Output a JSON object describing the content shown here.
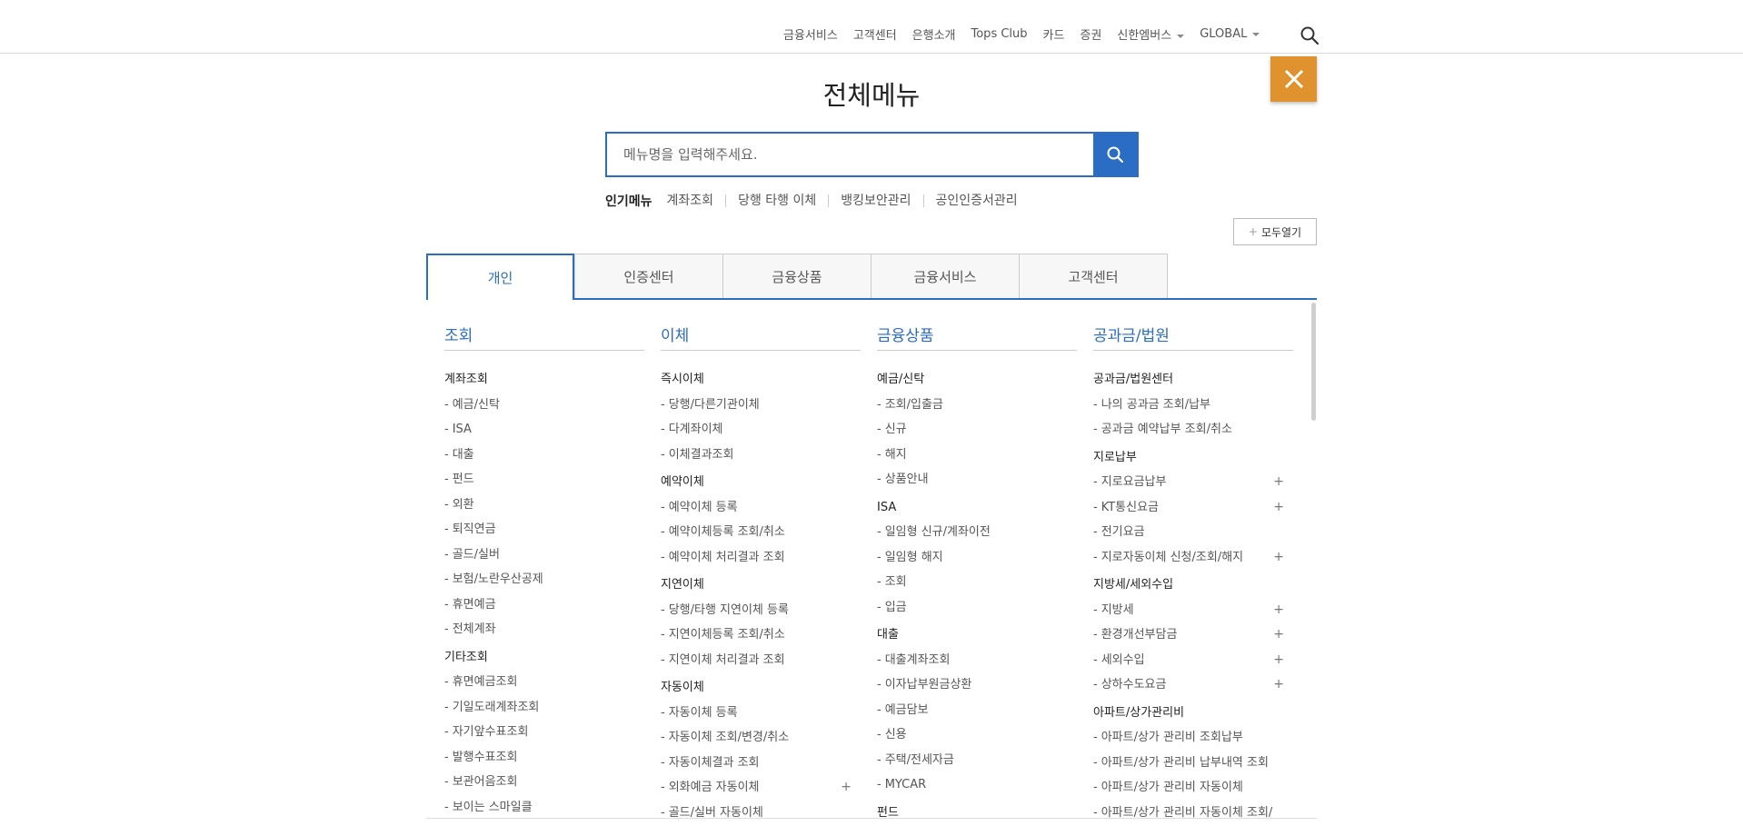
{
  "topnav": {
    "items": [
      {
        "label": "금융서비스",
        "dropdown": false
      },
      {
        "label": "고객센터",
        "dropdown": false
      },
      {
        "label": "은행소개",
        "dropdown": false
      },
      {
        "label": "Tops Club",
        "dropdown": false
      },
      {
        "label": "카드",
        "dropdown": false
      },
      {
        "label": "증권",
        "dropdown": false
      },
      {
        "label": "신한엠버스",
        "dropdown": true
      },
      {
        "label": "GLOBAL",
        "dropdown": true
      }
    ],
    "search_icon": "search-icon"
  },
  "close_button": {
    "icon": "close-icon",
    "color": "#e0922f"
  },
  "title": "전체메뉴",
  "search": {
    "placeholder": "메뉴명을 입력해주세요.",
    "icon": "search-icon"
  },
  "popular": {
    "label": "인기메뉴",
    "items": [
      "계좌조회",
      "당행 타행 이체",
      "뱅킹보안관리",
      "공인인증서관리"
    ]
  },
  "expand_all": "모두열기",
  "tabs": [
    {
      "label": "개인",
      "active": true
    },
    {
      "label": "인증센터",
      "active": false
    },
    {
      "label": "금융상품",
      "active": false
    },
    {
      "label": "금융서비스",
      "active": false
    },
    {
      "label": "고객센터",
      "active": false
    }
  ],
  "accent_color": "#2b6cc4",
  "columns": [
    {
      "title": "조회",
      "rows": [
        {
          "type": "group",
          "label": "계좌조회"
        },
        {
          "type": "item",
          "label": "예금/신탁"
        },
        {
          "type": "item",
          "label": "ISA"
        },
        {
          "type": "item",
          "label": "대출"
        },
        {
          "type": "item",
          "label": "펀드"
        },
        {
          "type": "item",
          "label": "외환"
        },
        {
          "type": "item",
          "label": "퇴직연금"
        },
        {
          "type": "item",
          "label": "골드/실버"
        },
        {
          "type": "item",
          "label": "보험/노란우산공제"
        },
        {
          "type": "item",
          "label": "휴면예금"
        },
        {
          "type": "item",
          "label": "전체계좌"
        },
        {
          "type": "group",
          "label": "기타조회"
        },
        {
          "type": "item",
          "label": "휴면예금조회"
        },
        {
          "type": "item",
          "label": "기일도래계좌조회"
        },
        {
          "type": "item",
          "label": "자기앞수표조회"
        },
        {
          "type": "item",
          "label": "발행수표조회"
        },
        {
          "type": "item",
          "label": "보관어음조회"
        },
        {
          "type": "item",
          "label": "보이는 스마일클"
        }
      ]
    },
    {
      "title": "이체",
      "rows": [
        {
          "type": "group",
          "label": "즉시이체"
        },
        {
          "type": "item",
          "label": "당행/다른기관이체"
        },
        {
          "type": "item",
          "label": "다계좌이체"
        },
        {
          "type": "item",
          "label": "이체결과조회"
        },
        {
          "type": "group",
          "label": "예약이체"
        },
        {
          "type": "item",
          "label": "예약이체 등록"
        },
        {
          "type": "item",
          "label": "예약이체등록 조회/취소"
        },
        {
          "type": "item",
          "label": "예약이체 처리결과 조회"
        },
        {
          "type": "group",
          "label": "지연이체"
        },
        {
          "type": "item",
          "label": "당행/타행 지연이체 등록"
        },
        {
          "type": "item",
          "label": "지연이체등록 조회/취소"
        },
        {
          "type": "item",
          "label": "지연이체 처리결과 조회"
        },
        {
          "type": "group",
          "label": "자동이체"
        },
        {
          "type": "item",
          "label": "자동이체 등록"
        },
        {
          "type": "item",
          "label": "자동이체 조회/변경/취소"
        },
        {
          "type": "item",
          "label": "자동이체결과 조회"
        },
        {
          "type": "item",
          "label": "외화예금 자동이체",
          "plus": true
        },
        {
          "type": "item",
          "label": "골드/실버 자동이체"
        }
      ]
    },
    {
      "title": "금융상품",
      "rows": [
        {
          "type": "group",
          "label": "예금/신탁"
        },
        {
          "type": "item",
          "label": "조회/입출금"
        },
        {
          "type": "item",
          "label": "신규"
        },
        {
          "type": "item",
          "label": "해지"
        },
        {
          "type": "item",
          "label": "상품안내"
        },
        {
          "type": "group",
          "label": "ISA"
        },
        {
          "type": "item",
          "label": "일임형 신규/계좌이전"
        },
        {
          "type": "item",
          "label": "일임형 해지"
        },
        {
          "type": "item",
          "label": "조회"
        },
        {
          "type": "item",
          "label": "입금"
        },
        {
          "type": "group",
          "label": "대출"
        },
        {
          "type": "item",
          "label": "대출계좌조회"
        },
        {
          "type": "item",
          "label": "이자납부원금상환"
        },
        {
          "type": "item",
          "label": "예금담보"
        },
        {
          "type": "item",
          "label": "신용"
        },
        {
          "type": "item",
          "label": "주택/전세자금"
        },
        {
          "type": "item",
          "label": "MYCAR"
        },
        {
          "type": "group",
          "label": "펀드"
        }
      ]
    },
    {
      "title": "공과금/법원",
      "rows": [
        {
          "type": "group",
          "label": "공과금/법원센터"
        },
        {
          "type": "item",
          "label": "나의 공과금 조회/납부"
        },
        {
          "type": "item",
          "label": "공과금 예약납부 조회/취소"
        },
        {
          "type": "group",
          "label": "지로납부"
        },
        {
          "type": "item",
          "label": "지로요금납부",
          "plus": true
        },
        {
          "type": "item",
          "label": "KT통신요금",
          "plus": true
        },
        {
          "type": "item",
          "label": "전기요금"
        },
        {
          "type": "item",
          "label": "지로자동이체 신청/조회/해지",
          "plus": true
        },
        {
          "type": "group",
          "label": "지방세/세외수입"
        },
        {
          "type": "item",
          "label": "지방세",
          "plus": true
        },
        {
          "type": "item",
          "label": "환경개선부담금",
          "plus": true
        },
        {
          "type": "item",
          "label": "세외수입",
          "plus": true
        },
        {
          "type": "item",
          "label": "상하수도요금",
          "plus": true
        },
        {
          "type": "group",
          "label": "아파트/상가관리비"
        },
        {
          "type": "item",
          "label": "아파트/상가 관리비 조회납부"
        },
        {
          "type": "item",
          "label": "아파트/상가 관리비 납부내역 조회"
        },
        {
          "type": "item",
          "label": "아파트/상가 관리비 자동이체"
        },
        {
          "type": "item",
          "label": "아파트/상가 관리비 자동이체 조회/"
        }
      ]
    }
  ]
}
